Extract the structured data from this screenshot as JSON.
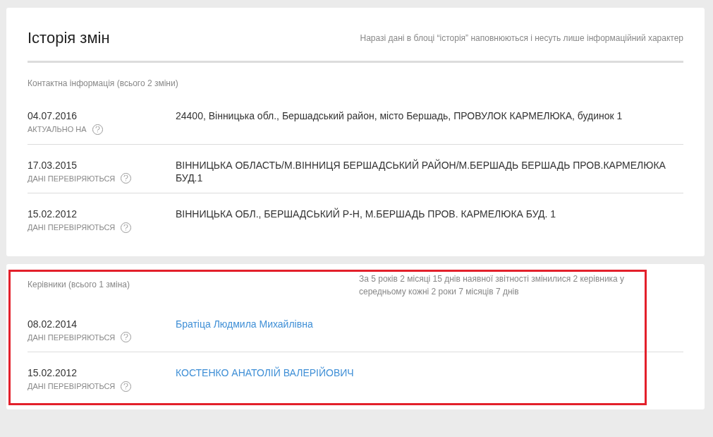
{
  "header": {
    "title": "Історія змін",
    "note": "Наразі дані в блоці “історія” наповнюються і несуть лише інформаційний характер"
  },
  "sections": [
    {
      "title": "Контактна інформація (всього 2 зміни)",
      "highlighted": false,
      "entries": [
        {
          "date": "04.07.2016",
          "status": "АКТУАЛЬНО НА",
          "kind": "text",
          "value": "24400, Вінницька обл., Бершадський район, місто Бершадь, ПРОВУЛОК КАРМЕЛЮКА, будинок 1"
        },
        {
          "date": "17.03.2015",
          "status": "ДАНІ ПЕРЕВІРЯЮТЬСЯ",
          "kind": "text",
          "value": "ВІННИЦЬКА ОБЛАСТЬ/М.ВІННИЦЯ БЕРШАДСЬКИЙ РАЙОН/М.БЕРШАДЬ БЕРШАДЬ ПРОВ.КАРМЕЛЮКА БУД.1"
        },
        {
          "date": "15.02.2012",
          "status": "ДАНІ ПЕРЕВІРЯЮТЬСЯ",
          "kind": "text",
          "value": "ВІННИЦЬКА ОБЛ., БЕРШАДСЬКИЙ Р-Н, М.БЕРШАДЬ ПРОВ. КАРМЕЛЮКА БУД. 1"
        }
      ]
    },
    {
      "title": "Керівники (всього 1 зміна)",
      "summary": "За 5 років 2 місяці 15 днів наявної звітності змінилися 2 керівника у середньому кожні 2 роки 7 місяців 7 днів",
      "highlighted": true,
      "entries": [
        {
          "date": "08.02.2014",
          "status": "ДАНІ ПЕРЕВІРЯЮТЬСЯ",
          "kind": "link",
          "value": "Братіца Людмила Михайлівна"
        },
        {
          "date": "15.02.2012",
          "status": "ДАНІ ПЕРЕВІРЯЮТЬСЯ",
          "kind": "link",
          "value": "КОСТЕНКО АНАТОЛІЙ ВАЛЕРІЙОВИЧ"
        }
      ]
    }
  ]
}
